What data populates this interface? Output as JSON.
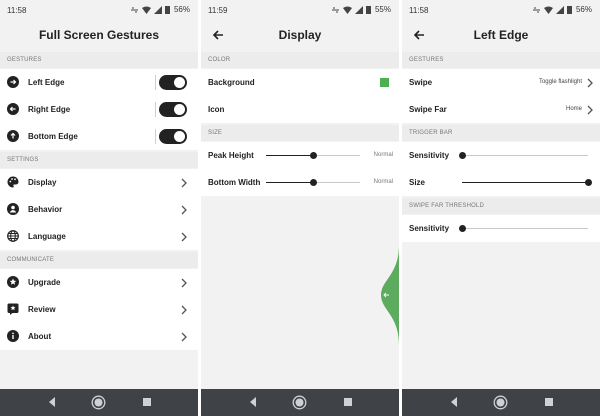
{
  "status": [
    {
      "time": "11:58",
      "battery": "56%"
    },
    {
      "time": "11:59",
      "battery": "55%"
    },
    {
      "time": "11:58",
      "battery": "56%"
    }
  ],
  "screen1": {
    "title": "Full Screen Gestures",
    "sections": {
      "gestures": "GESTURES",
      "settings": "SETTINGS",
      "communicate": "COMMUNICATE"
    },
    "items": {
      "left_edge": "Left Edge",
      "right_edge": "Right Edge",
      "bottom_edge": "Bottom Edge",
      "display": "Display",
      "behavior": "Behavior",
      "language": "Language",
      "upgrade": "Upgrade",
      "review": "Review",
      "about": "About"
    },
    "toggles": {
      "left_edge": true,
      "right_edge": true,
      "bottom_edge": true
    }
  },
  "screen2": {
    "title": "Display",
    "sections": {
      "color": "COLOR",
      "size": "SIZE"
    },
    "items": {
      "background": "Background",
      "icon": "Icon",
      "peak_height": "Peak Height",
      "bottom_width": "Bottom Width"
    },
    "values": {
      "peak_height": "Normal",
      "bottom_width": "Normal"
    },
    "slider_levels": {
      "peak_height": 0.5,
      "bottom_width": 0.5
    },
    "colors": {
      "background": "#4caf50",
      "icon": "#ffffff",
      "edge_handle": "#5cab5e"
    }
  },
  "screen3": {
    "title": "Left Edge",
    "sections": {
      "gestures": "GESTURES",
      "trigger_bar": "TRIGGER BAR",
      "swipe_far_threshold": "SWIPE FAR THRESHOLD"
    },
    "items": {
      "swipe": "Swipe",
      "swipe_far": "Swipe Far",
      "sensitivity": "Sensitivity",
      "size": "Size",
      "threshold_sensitivity": "Sensitivity"
    },
    "values": {
      "swipe": "Toggle flashlight",
      "swipe_far": "Home"
    },
    "slider_levels": {
      "sensitivity": 0.0,
      "size": 1.0,
      "threshold_sensitivity": 0.0
    }
  },
  "icons": {
    "nav_back": "back-triangle-icon",
    "nav_home": "home-circle-icon",
    "nav_recents": "recents-square-icon"
  }
}
